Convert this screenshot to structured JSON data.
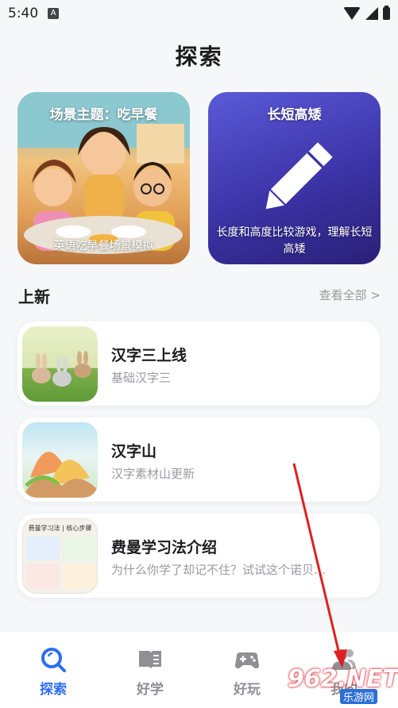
{
  "status_bar": {
    "time": "5:40",
    "notification_letter": "A"
  },
  "page": {
    "title": "探索"
  },
  "featured": [
    {
      "title": "场景主题：吃早餐",
      "caption": "英语吃早餐场景模拟"
    },
    {
      "title": "长短高矮",
      "caption": "长度和高度比较游戏，理解长短高矮"
    }
  ],
  "new_section": {
    "title": "上新",
    "view_all": "查看全部 >"
  },
  "items": [
    {
      "title": "汉字三上线",
      "subtitle": "基础汉字三"
    },
    {
      "title": "汉字山",
      "subtitle": "汉字素材山更新"
    },
    {
      "title": "费曼学习法介绍",
      "subtitle": "为什么你学了却记不住？试试这个诺贝…",
      "thumb_heading": "费曼学习法 | 核心步骤"
    }
  ],
  "nav": [
    {
      "label": "探索",
      "icon": "explore-icon",
      "active": true
    },
    {
      "label": "好学",
      "icon": "book-icon",
      "active": false
    },
    {
      "label": "好玩",
      "icon": "gamepad-icon",
      "active": false
    },
    {
      "label": "我的",
      "icon": "profile-icon",
      "active": false
    }
  ],
  "watermark": {
    "text": "962.NET",
    "sub": "乐游网"
  },
  "colors": {
    "accent": "#2d6cf5",
    "muted": "#8f8f94",
    "card_purple": "#3c33a6",
    "arrow": "#e02020"
  }
}
